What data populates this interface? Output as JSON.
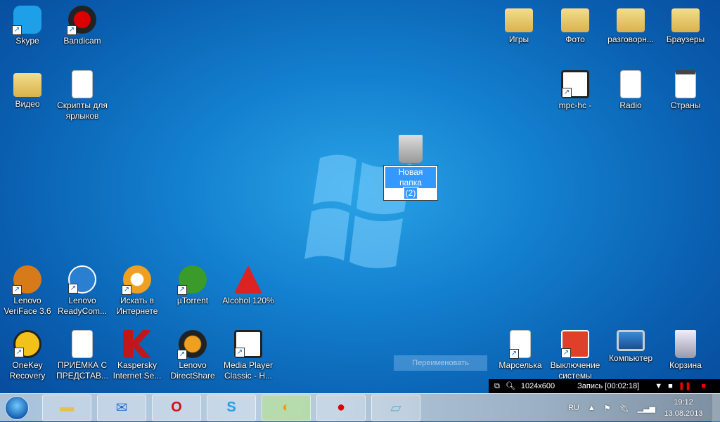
{
  "desktop": {
    "top_left": [
      {
        "label": "Skype"
      },
      {
        "label": "Bandicam"
      },
      {
        "label": "Видео"
      },
      {
        "label": "Скрипты для ярлыков"
      }
    ],
    "top_right": [
      {
        "label": "Игры"
      },
      {
        "label": "Фото"
      },
      {
        "label": "разговорн..."
      },
      {
        "label": "Браузеры"
      },
      {
        "label": "mpc-hc -"
      },
      {
        "label": "Radio"
      },
      {
        "label": "Страны"
      }
    ],
    "renaming": {
      "value_line1": "Новая папка",
      "value_line2": "(2)"
    },
    "row1": [
      {
        "label": "Lenovo VeriFace 3.6"
      },
      {
        "label": "Lenovo ReadyCom..."
      },
      {
        "label": "Искать в Интернете"
      },
      {
        "label": "µTorrent"
      },
      {
        "label": "Alcohol 120%"
      }
    ],
    "row2": [
      {
        "label": "OneKey Recovery"
      },
      {
        "label": "ПРИЁМКА С ПРЕДСТАВ..."
      },
      {
        "label": "Kaspersky Internet Se..."
      },
      {
        "label": "Lenovo DirectShare"
      },
      {
        "label": "Media Player Classic - H..."
      }
    ],
    "bottom_right": [
      {
        "label": "Марселька"
      },
      {
        "label": "Выключение системы"
      },
      {
        "label": "Компьютер"
      },
      {
        "label": "Корзина"
      }
    ]
  },
  "rename_hint": "Переименовать",
  "recorder": {
    "resolution": "1024x600",
    "status": "Запись [00:02:18]"
  },
  "taskbar": {
    "apps": [
      "explorer",
      "mail",
      "opera",
      "skype",
      "app",
      "bandicam",
      "notepad"
    ],
    "lang": "RU",
    "time": "19:12",
    "date": "13.08.2013"
  }
}
